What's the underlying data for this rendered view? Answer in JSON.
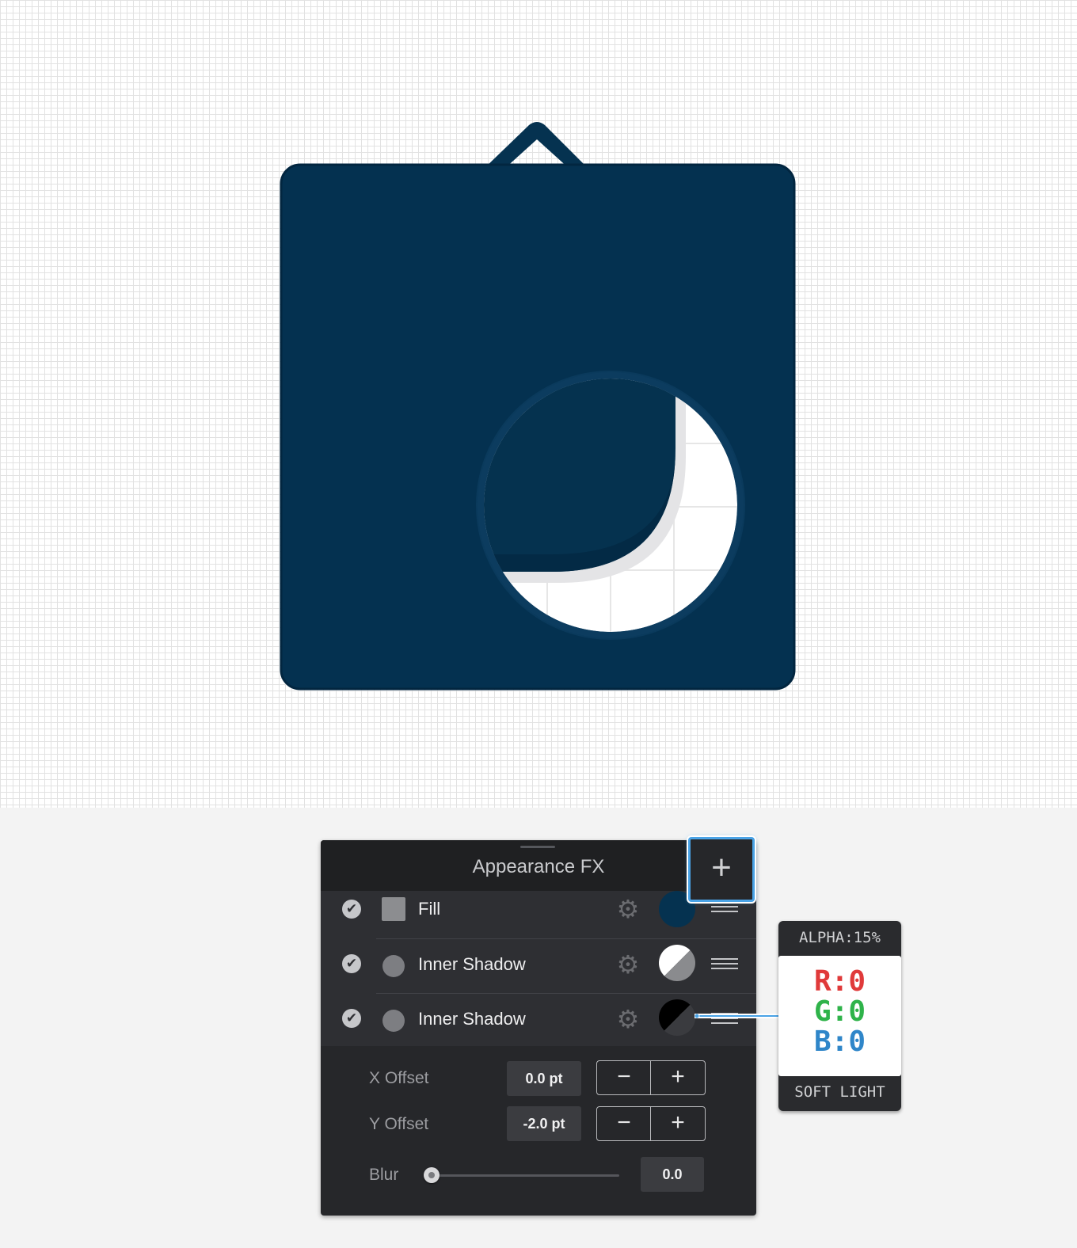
{
  "panel": {
    "title": "Appearance FX",
    "add_label": "+",
    "effects": [
      {
        "label": "Fill",
        "check": "✔"
      },
      {
        "label": "Inner Shadow",
        "check": "✔"
      },
      {
        "label": "Inner Shadow",
        "check": "✔"
      }
    ],
    "x_offset": {
      "label": "X Offset",
      "value": "0.0 pt",
      "minus": "−",
      "plus": "+"
    },
    "y_offset": {
      "label": "Y Offset",
      "value": "-2.0 pt",
      "minus": "−",
      "plus": "+"
    },
    "blur": {
      "label": "Blur",
      "value": "0.0",
      "level": 0
    }
  },
  "tooltip": {
    "alpha": "ALPHA:15%",
    "r": "R:0",
    "g": "G:0",
    "b": "B:0",
    "blend": "SOFT LIGHT"
  },
  "colors": {
    "navy": "#053250",
    "accent": "#4aa3e6",
    "red": "#e03a3a",
    "green": "#2fb34a",
    "blue": "#2f86c9"
  }
}
